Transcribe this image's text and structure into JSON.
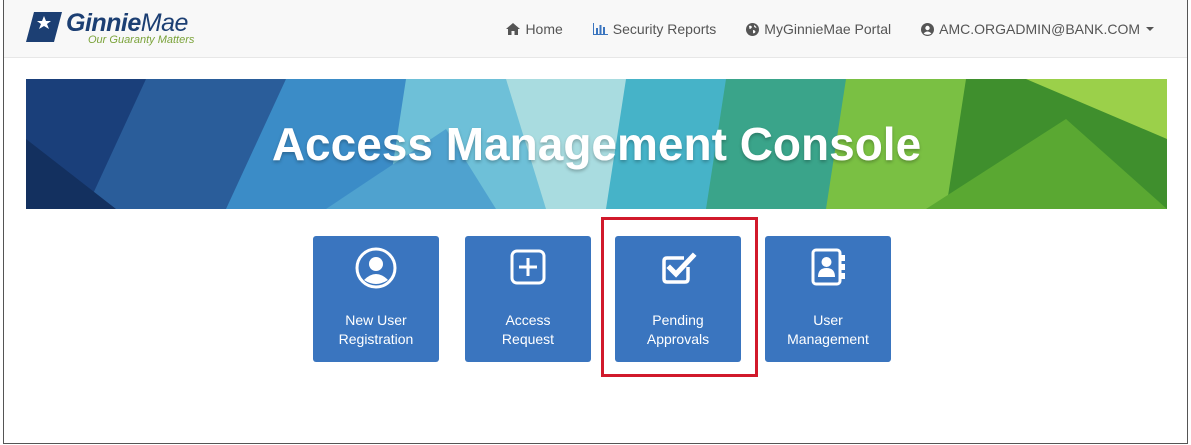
{
  "header": {
    "logo": {
      "name_bold": "Ginnie",
      "name_light": "Mae",
      "tagline": "Our Guaranty Matters"
    },
    "nav": [
      {
        "label": "Home",
        "icon": "home-icon"
      },
      {
        "label": "Security Reports",
        "icon": "bar-chart-icon"
      },
      {
        "label": "MyGinnieMae Portal",
        "icon": "globe-icon"
      },
      {
        "label": "AMC.ORGADMIN@BANK.COM",
        "icon": "user-circle-icon"
      }
    ]
  },
  "banner": {
    "title": "Access Management Console"
  },
  "tiles": [
    {
      "line1": "New User",
      "line2": "Registration",
      "icon": "user-circle-icon"
    },
    {
      "line1": "Access",
      "line2": "Request",
      "icon": "plus-square-icon"
    },
    {
      "line1": "Pending",
      "line2": "Approvals",
      "icon": "check-square-icon"
    },
    {
      "line1": "User",
      "line2": "Management",
      "icon": "address-book-icon"
    }
  ],
  "colors": {
    "tile": "#3a75bf",
    "highlight": "#d1192b",
    "brand_navy": "#1c3f73",
    "brand_green": "#7ba33a"
  }
}
